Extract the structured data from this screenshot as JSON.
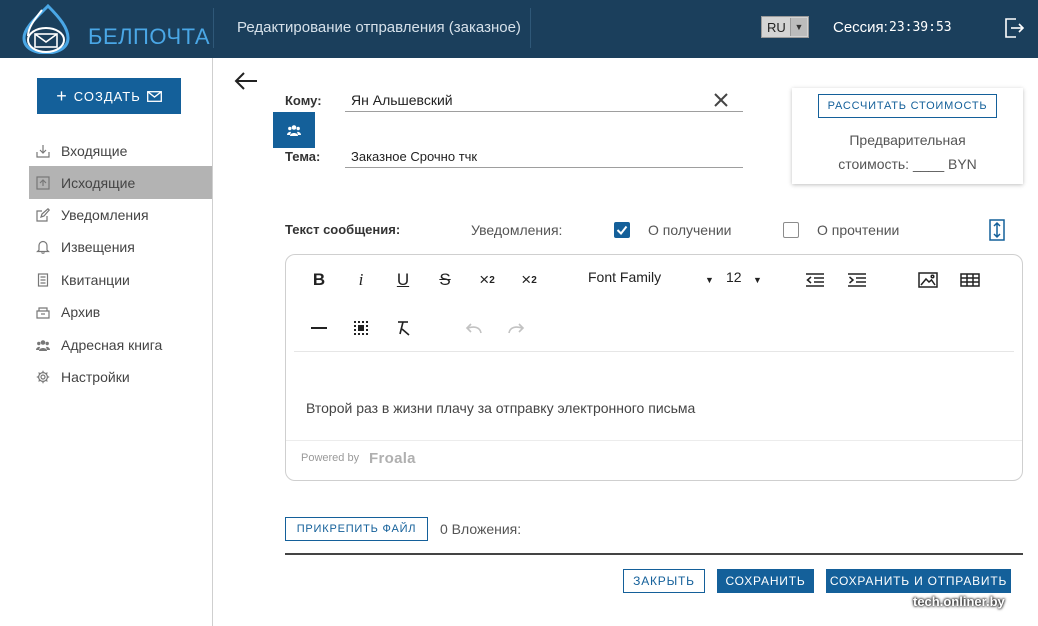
{
  "header": {
    "logo_text": "БЕЛПОЧТА",
    "page_title": "Редактирование отправления (заказное)",
    "language": "RU",
    "session_label": "Сессия:",
    "session_time": "23:39:53",
    "logout_icon": "logout-icon"
  },
  "sidebar": {
    "create_label": "СОЗДАТЬ",
    "items": [
      {
        "label": "Входящие",
        "icon": "inbox-icon",
        "active": false
      },
      {
        "label": "Исходящие",
        "icon": "outbox-icon",
        "active": true
      },
      {
        "label": "Уведомления",
        "icon": "edit-icon",
        "active": false
      },
      {
        "label": "Извещения",
        "icon": "bell-icon",
        "active": false
      },
      {
        "label": "Квитанции",
        "icon": "receipt-icon",
        "active": false
      },
      {
        "label": "Архив",
        "icon": "archive-icon",
        "active": false
      },
      {
        "label": "Адресная книга",
        "icon": "users-icon",
        "active": false
      },
      {
        "label": "Настройки",
        "icon": "gear-icon",
        "active": false
      }
    ]
  },
  "form": {
    "to_label": "Кому:",
    "to_value": "Ян Альшевский",
    "subject_label": "Тема:",
    "subject_value": "Заказное Срочно тчк"
  },
  "cost": {
    "calc_button": "РАССЧИТАТЬ СТОИМОСТЬ",
    "line1": "Предварительная",
    "line2": "стоимость: ____ BYN"
  },
  "message": {
    "label": "Текст сообщения:",
    "notifications_label": "Уведомления:",
    "on_receipt_label": "О получении",
    "on_receipt_checked": true,
    "on_read_label": "О прочтении",
    "on_read_checked": false
  },
  "editor": {
    "font_family": "Font Family",
    "font_size": "12",
    "body_text": "Второй раз в жизни плачу за отправку электронного письма",
    "powered_by": "Powered by",
    "brand": "Froala"
  },
  "attachments": {
    "attach_button": "ПРИКРЕПИТЬ ФАЙЛ",
    "label": "0 Вложения:"
  },
  "actions": {
    "close": "ЗАКРЫТЬ",
    "save": "СОХРАНИТЬ",
    "save_send": "СОХРАНИТЬ И ОТПРАВИТЬ"
  },
  "watermark": "tech.onliner.by",
  "colors": {
    "header_bg": "#1b3f5c",
    "accent": "#14609a",
    "active_nav": "#b3b3b3"
  }
}
